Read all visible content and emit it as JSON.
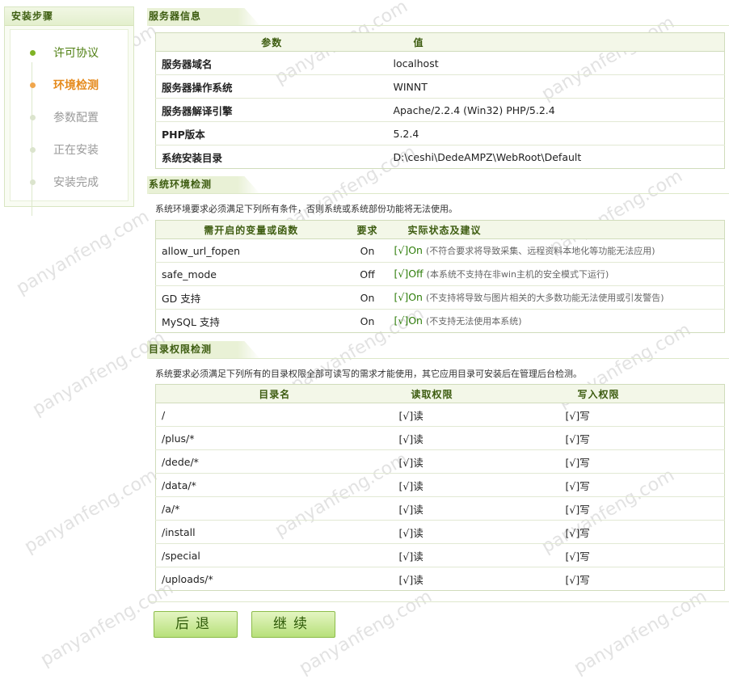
{
  "sidebar": {
    "title": "安装步骤",
    "steps": [
      {
        "label": "许可协议",
        "state": "done"
      },
      {
        "label": "环境检测",
        "state": "current"
      },
      {
        "label": "参数配置",
        "state": "todo"
      },
      {
        "label": "正在安装",
        "state": "todo"
      },
      {
        "label": "安装完成",
        "state": "todo"
      }
    ]
  },
  "server_info": {
    "title": "服务器信息",
    "headers": [
      "参数",
      "值"
    ],
    "rows": [
      [
        "服务器域名",
        "localhost"
      ],
      [
        "服务器操作系统",
        "WINNT"
      ],
      [
        "服务器解译引擎",
        "Apache/2.2.4 (Win32) PHP/5.2.4"
      ],
      [
        "PHP版本",
        "5.2.4"
      ],
      [
        "系统安装目录",
        "D:\\ceshi\\DedeAMPZ\\WebRoot\\Default"
      ]
    ]
  },
  "env_check": {
    "title": "系统环境检测",
    "desc": "系统环境要求必须满足下列所有条件，否则系统或系统部份功能将无法使用。",
    "headers": [
      "需开启的变量或函数",
      "要求",
      "实际状态及建议"
    ],
    "rows": [
      {
        "name": "allow_url_fopen",
        "req": "On",
        "status": "[√]On",
        "note": "(不符合要求将导致采集、远程资料本地化等功能无法应用)"
      },
      {
        "name": "safe_mode",
        "req": "Off",
        "status": "[√]Off",
        "note": "(本系统不支持在非win主机的安全模式下运行)"
      },
      {
        "name": "GD 支持",
        "req": "On",
        "status": "[√]On",
        "note": "(不支持将导致与图片相关的大多数功能无法使用或引发警告)"
      },
      {
        "name": "MySQL 支持",
        "req": "On",
        "status": "[√]On",
        "note": "(不支持无法使用本系统)"
      }
    ]
  },
  "dir_check": {
    "title": "目录权限检测",
    "desc": "系统要求必须满足下列所有的目录权限全部可读写的需求才能使用，其它应用目录可安装后在管理后台检测。",
    "headers": [
      "目录名",
      "读取权限",
      "写入权限"
    ],
    "rows": [
      {
        "dir": "/",
        "read": "[√]读",
        "write": "[√]写"
      },
      {
        "dir": "/plus/*",
        "read": "[√]读",
        "write": "[√]写"
      },
      {
        "dir": "/dede/*",
        "read": "[√]读",
        "write": "[√]写"
      },
      {
        "dir": "/data/*",
        "read": "[√]读",
        "write": "[√]写"
      },
      {
        "dir": "/a/*",
        "read": "[√]读",
        "write": "[√]写"
      },
      {
        "dir": "/install",
        "read": "[√]读",
        "write": "[√]写"
      },
      {
        "dir": "/special",
        "read": "[√]读",
        "write": "[√]写"
      },
      {
        "dir": "/uploads/*",
        "read": "[√]读",
        "write": "[√]写"
      }
    ]
  },
  "buttons": {
    "back": "后退",
    "next": "继续"
  },
  "watermark": "panyanfeng.com"
}
